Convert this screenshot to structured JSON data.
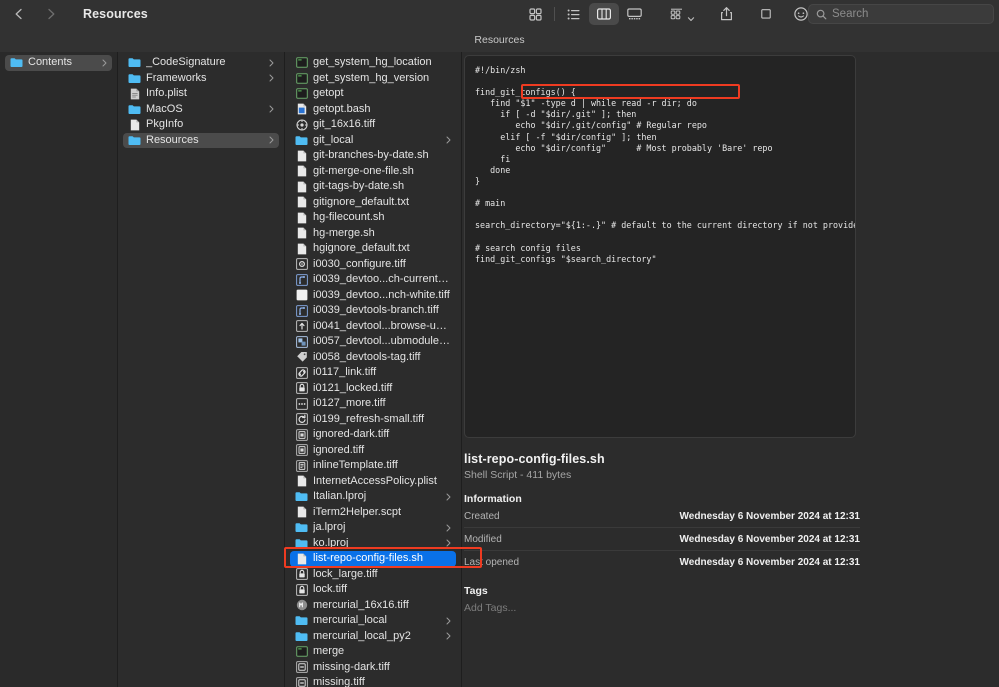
{
  "window": {
    "title": "Resources",
    "path_bar_label": "Resources"
  },
  "toolbar": {
    "back_icon": "chevron-left-icon",
    "forward_icon": "chevron-right-icon",
    "view_icon_grid": "grid-view-icon",
    "view_icon_list": "list-view-icon",
    "view_icon_columns": "column-view-icon",
    "view_icon_gallery": "gallery-view-icon",
    "group_icon": "group-by-icon",
    "share_icon": "share-icon",
    "tag_icon": "tag-icon",
    "more_icon": "more-actions-icon",
    "search_placeholder": "Search",
    "search_value": "",
    "search_icon": "search-icon",
    "active_view": "columns"
  },
  "sidebar": {
    "items": [
      {
        "label": "Contents",
        "icon": "folder-icon",
        "selected": true,
        "disclosure": true
      }
    ]
  },
  "column_a": {
    "items": [
      {
        "label": "_CodeSignature",
        "icon": "folder-icon",
        "disclosure": true,
        "selected": false
      },
      {
        "label": "Frameworks",
        "icon": "folder-icon",
        "disclosure": true,
        "selected": false
      },
      {
        "label": "Info.plist",
        "icon": "plist-icon",
        "disclosure": false,
        "selected": false
      },
      {
        "label": "MacOS",
        "icon": "folder-icon",
        "disclosure": true,
        "selected": false
      },
      {
        "label": "PkgInfo",
        "icon": "doc-icon",
        "disclosure": false,
        "selected": false
      },
      {
        "label": "Resources",
        "icon": "folder-icon",
        "disclosure": true,
        "selected": true
      }
    ]
  },
  "column_b": {
    "items": [
      {
        "label": "get_system_hg_location",
        "icon": "script-icon",
        "disclosure": false,
        "selected": false
      },
      {
        "label": "get_system_hg_version",
        "icon": "script-icon",
        "disclosure": false,
        "selected": false
      },
      {
        "label": "getopt",
        "icon": "script-icon",
        "disclosure": false,
        "selected": false
      },
      {
        "label": "getopt.bash",
        "icon": "bash-icon",
        "disclosure": false,
        "selected": false
      },
      {
        "label": "git_16x16.tiff",
        "icon": "git-icon",
        "disclosure": false,
        "selected": false
      },
      {
        "label": "git_local",
        "icon": "folder-icon",
        "disclosure": true,
        "selected": false
      },
      {
        "label": "git-branches-by-date.sh",
        "icon": "doc-icon",
        "disclosure": false,
        "selected": false
      },
      {
        "label": "git-merge-one-file.sh",
        "icon": "doc-icon",
        "disclosure": false,
        "selected": false
      },
      {
        "label": "git-tags-by-date.sh",
        "icon": "doc-icon",
        "disclosure": false,
        "selected": false
      },
      {
        "label": "gitignore_default.txt",
        "icon": "doc-icon",
        "disclosure": false,
        "selected": false
      },
      {
        "label": "hg-filecount.sh",
        "icon": "doc-icon",
        "disclosure": false,
        "selected": false
      },
      {
        "label": "hg-merge.sh",
        "icon": "doc-icon",
        "disclosure": false,
        "selected": false
      },
      {
        "label": "hgignore_default.txt",
        "icon": "doc-icon",
        "disclosure": false,
        "selected": false
      },
      {
        "label": "i0030_configure.tiff",
        "icon": "gear-icon",
        "disclosure": false,
        "selected": false
      },
      {
        "label": "i0039_devtoo...ch-current.tiff",
        "icon": "branch-icon",
        "disclosure": false,
        "selected": false
      },
      {
        "label": "i0039_devtoo...nch-white.tiff",
        "icon": "white-square-icon",
        "disclosure": false,
        "selected": false
      },
      {
        "label": "i0039_devtools-branch.tiff",
        "icon": "branch-icon",
        "disclosure": false,
        "selected": false
      },
      {
        "label": "i0041_devtool...browse-up.tiff",
        "icon": "arrow-up-icon",
        "disclosure": false,
        "selected": false
      },
      {
        "label": "i0057_devtool...ubmodule.tiff",
        "icon": "submodule-icon",
        "disclosure": false,
        "selected": false
      },
      {
        "label": "i0058_devtools-tag.tiff",
        "icon": "tag-icon",
        "disclosure": false,
        "selected": false
      },
      {
        "label": "i0117_link.tiff",
        "icon": "link-icon",
        "disclosure": false,
        "selected": false
      },
      {
        "label": "i0121_locked.tiff",
        "icon": "lock-icon",
        "disclosure": false,
        "selected": false
      },
      {
        "label": "i0127_more.tiff",
        "icon": "more-dots-icon",
        "disclosure": false,
        "selected": false
      },
      {
        "label": "i0199_refresh-small.tiff",
        "icon": "refresh-icon",
        "disclosure": false,
        "selected": false
      },
      {
        "label": "ignored-dark.tiff",
        "icon": "ignored-icon",
        "disclosure": false,
        "selected": false
      },
      {
        "label": "ignored.tiff",
        "icon": "ignored-icon",
        "disclosure": false,
        "selected": false
      },
      {
        "label": "inlineTemplate.tiff",
        "icon": "template-icon",
        "disclosure": false,
        "selected": false
      },
      {
        "label": "InternetAccessPolicy.plist",
        "icon": "doc-icon",
        "disclosure": false,
        "selected": false
      },
      {
        "label": "Italian.lproj",
        "icon": "folder-icon",
        "disclosure": true,
        "selected": false
      },
      {
        "label": "iTerm2Helper.scpt",
        "icon": "doc-icon",
        "disclosure": false,
        "selected": false
      },
      {
        "label": "ja.lproj",
        "icon": "folder-icon",
        "disclosure": true,
        "selected": false
      },
      {
        "label": "ko.lproj",
        "icon": "folder-icon",
        "disclosure": true,
        "selected": false
      },
      {
        "label": "list-repo-config-files.sh",
        "icon": "doc-icon",
        "disclosure": false,
        "selected": true
      },
      {
        "label": "lock_large.tiff",
        "icon": "lock-icon",
        "disclosure": false,
        "selected": false
      },
      {
        "label": "lock.tiff",
        "icon": "lock-icon",
        "disclosure": false,
        "selected": false
      },
      {
        "label": "mercurial_16x16.tiff",
        "icon": "mercurial-icon",
        "disclosure": false,
        "selected": false
      },
      {
        "label": "mercurial_local",
        "icon": "folder-icon",
        "disclosure": true,
        "selected": false
      },
      {
        "label": "mercurial_local_py2",
        "icon": "folder-icon",
        "disclosure": true,
        "selected": false
      },
      {
        "label": "merge",
        "icon": "script-icon",
        "disclosure": false,
        "selected": false
      },
      {
        "label": "missing-dark.tiff",
        "icon": "missing-icon",
        "disclosure": false,
        "selected": false
      },
      {
        "label": "missing.tiff",
        "icon": "missing-icon",
        "disclosure": false,
        "selected": false
      }
    ]
  },
  "preview": {
    "code": "#!/bin/zsh\n\nfind_git_configs() {\n   find \"$1\" -type d | while read -r dir; do\n     if [ -d \"$dir/.git\" ]; then\n        echo \"$dir/.git/config\" # Regular repo\n     elif [ -f \"$dir/config\" ]; then\n        echo \"$dir/config\"      # Most probably 'Bare' repo\n     fi\n   done\n}\n\n# main\n\nsearch_directory=\"${1:-.}\" # default to the current directory if not provided\n\n# search config files\nfind_git_configs \"$search_directory\"",
    "file_name": "list-repo-config-files.sh",
    "file_subtitle": "Shell Script - 411 bytes",
    "information_heading": "Information",
    "rows": [
      {
        "key": "Created",
        "value": "Wednesday 6 November 2024 at 12:31"
      },
      {
        "key": "Modified",
        "value": "Wednesday 6 November 2024 at 12:31"
      },
      {
        "key": "Last opened",
        "value": "Wednesday 6 November 2024 at 12:31"
      }
    ],
    "tags_heading": "Tags",
    "tags_placeholder": "Add Tags..."
  },
  "annotations": {
    "accent_color": "#ef3b21",
    "code_highlight_target": "find \"$1\" -type d",
    "file_highlight_target": "list-repo-config-files.sh"
  },
  "colors": {
    "selection_blue": "#0a71e8",
    "selection_grey": "#4b4b4b",
    "folder_blue": "#54bdf4",
    "window_bg": "#2c2c2c"
  }
}
